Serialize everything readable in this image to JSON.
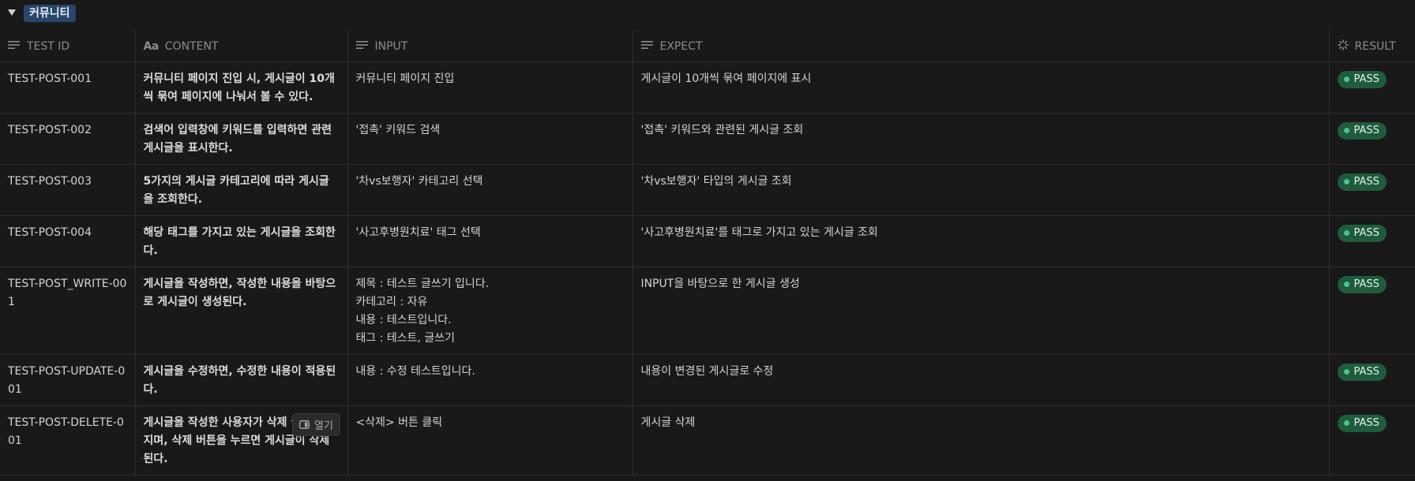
{
  "group": {
    "title": "커뮤니티"
  },
  "columns": {
    "test_id": "TEST ID",
    "content": "CONTENT",
    "input": "INPUT",
    "expect": "EXPECT",
    "result": "RESULT"
  },
  "rows": [
    {
      "id": "TEST-POST-001",
      "content": "커뮤니티 페이지 진입 시, 게시글이 10개씩 묶여 페이지에 나눠서 볼 수 있다.",
      "input": [
        "커뮤니티 페이지 진입"
      ],
      "expect": "게시글이 10개씩 묶여 페이지에 표시",
      "result": "PASS"
    },
    {
      "id": "TEST-POST-002",
      "content": "검색어 입력창에 키워드를 입력하면 관련 게시글을 표시한다.",
      "input": [
        "'접촉' 키워드 검색"
      ],
      "expect": "'접촉' 키워드와 관련된 게시글 조회",
      "result": "PASS"
    },
    {
      "id": "TEST-POST-003",
      "content": "5가지의 게시글 카테고리에 따라 게시글을 조회한다.",
      "input": [
        "'차vs보행자' 카테고리 선택"
      ],
      "expect": "'차vs보행자' 타입의 게시글 조회",
      "result": "PASS"
    },
    {
      "id": "TEST-POST-004",
      "content": "해당 태그를 가지고 있는 게시글을 조회한다.",
      "input": [
        "'사고후병원치료' 태그 선택"
      ],
      "expect": "'사고후병원치료'를 태그로 가지고 있는 게시글 조회",
      "result": "PASS"
    },
    {
      "id": "TEST-POST_WRITE-001",
      "content": "게시글을 작성하면, 작성한 내용을 바탕으로 게시글이 생성된다.",
      "input": [
        "제목 : 테스트 글쓰기 입니다.",
        "카테고리 : 자유",
        "내용 : 테스트입니다.",
        "태그 : 테스트, 글쓰기"
      ],
      "expect": "INPUT을 바탕으로 한 게시글 생성",
      "result": "PASS"
    },
    {
      "id": "TEST-POST-UPDATE-001",
      "content": "게시글을 수정하면, 수정한 내용이 적용된다.",
      "input": [
        "내용 : 수정 테스트입니다."
      ],
      "expect": "내용이 변경된 게시글로 수정",
      "result": "PASS"
    },
    {
      "id": "TEST-POST-DELETE-001",
      "content": "게시글을 작성한 사용자가 삭제 권한을 가지며, 삭제 버튼을 누르면 게시글이 삭제된다.",
      "input": [
        "<삭제> 버튼 클릭"
      ],
      "expect": "게시글 삭제",
      "result": "PASS"
    }
  ],
  "open_button": {
    "label": "열기"
  },
  "colors": {
    "background": "#191919",
    "badge": "#28456c",
    "pass_bg": "#1f5b3d",
    "pass_dot": "#4cc38a"
  }
}
